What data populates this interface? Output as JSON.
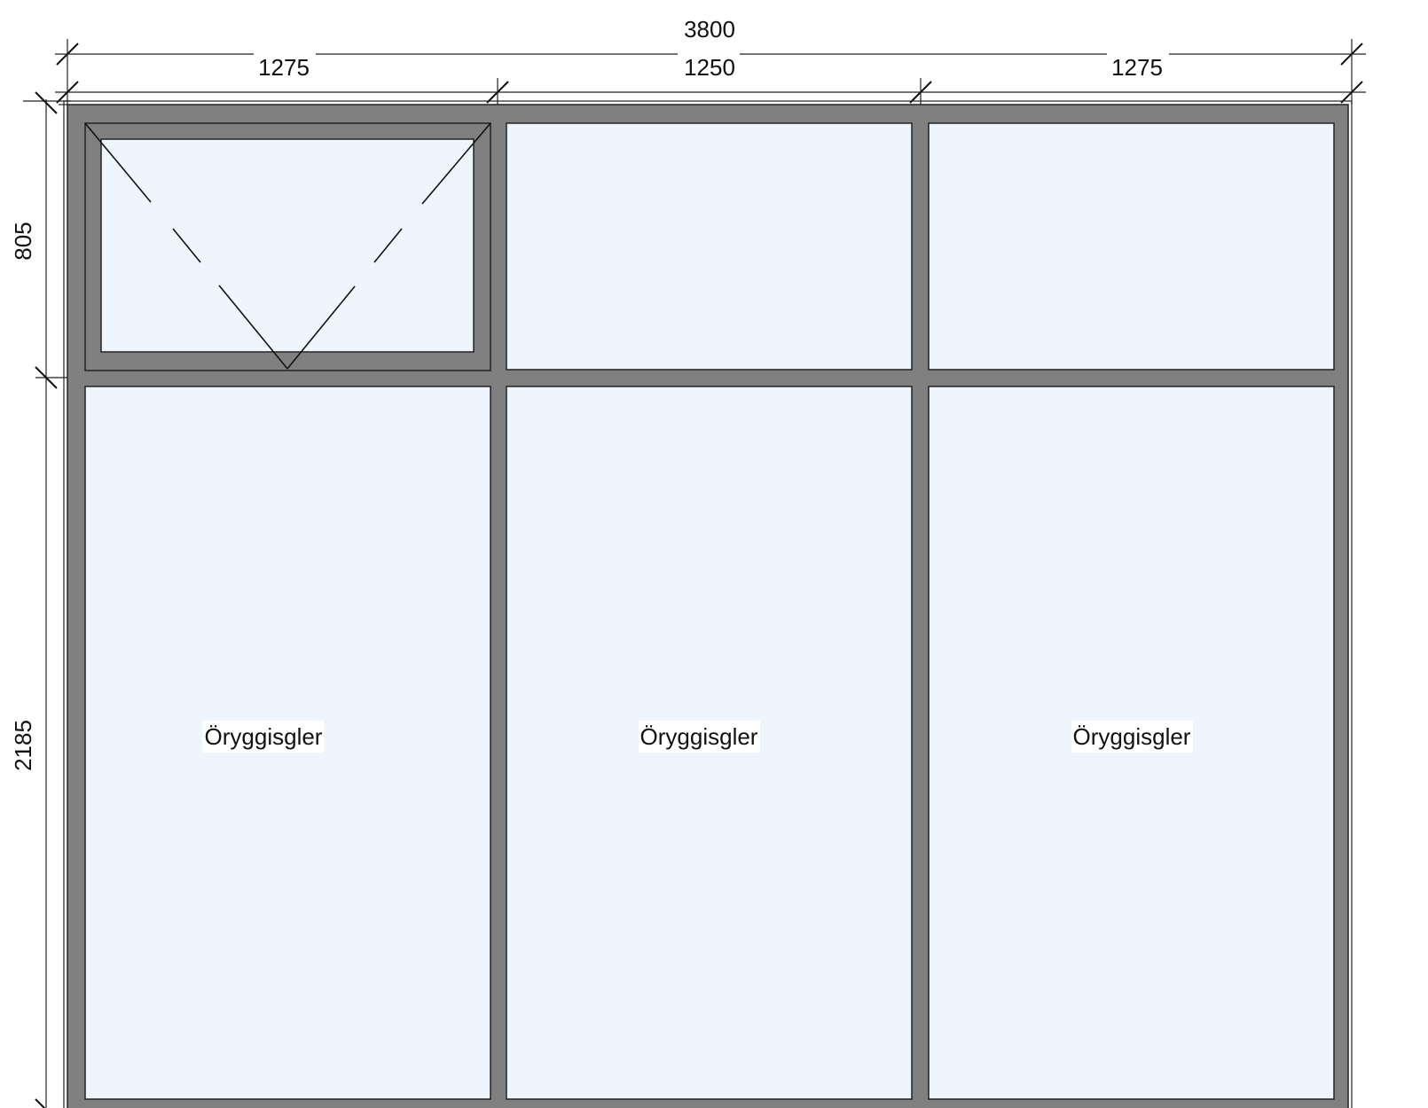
{
  "dimensions": {
    "overall_width": "3800",
    "column_widths": [
      "1275",
      "1250",
      "1275"
    ],
    "row_heights": [
      "805",
      "2185"
    ]
  },
  "panes": {
    "lower_labels": [
      "Öryggisgler",
      "Öryggisgler",
      "Öryggisgler"
    ]
  },
  "colors": {
    "frame": "#808080",
    "glass": "#eef5fc"
  }
}
